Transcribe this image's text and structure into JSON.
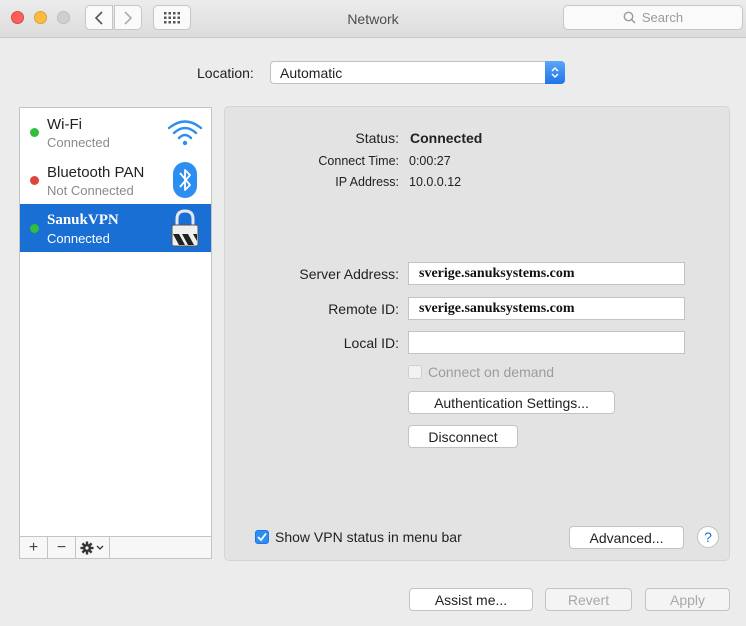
{
  "window": {
    "title": "Network",
    "search_placeholder": "Search"
  },
  "location": {
    "label": "Location:",
    "value": "Automatic"
  },
  "services": [
    {
      "name": "Wi-Fi",
      "status": "Connected",
      "status_color": "#2fbf3c",
      "icon": "wifi-icon",
      "selected": false
    },
    {
      "name": "Bluetooth PAN",
      "status": "Not Connected",
      "status_color": "#e0443e",
      "icon": "bluetooth-icon",
      "selected": false
    },
    {
      "name": "SanukVPN",
      "status": "Connected",
      "status_color": "#2fbf3c",
      "icon": "vpn-lock-icon",
      "selected": true
    }
  ],
  "sidebar_tools": {
    "add": "+",
    "remove": "−",
    "action": "gear-icon"
  },
  "detail": {
    "status_label": "Status:",
    "status_value": "Connected",
    "connect_time_label": "Connect Time:",
    "connect_time_value": "0:00:27",
    "ip_label": "IP Address:",
    "ip_value": "10.0.0.12",
    "server_label": "Server Address:",
    "server_value": "sverige.sanuksystems.com",
    "remote_label": "Remote ID:",
    "remote_value": "sverige.sanuksystems.com",
    "local_label": "Local ID:",
    "local_value": "",
    "connect_on_demand_label": "Connect on demand",
    "connect_on_demand_checked": false,
    "auth_button": "Authentication Settings...",
    "disconnect_button": "Disconnect",
    "show_status_label": "Show VPN status in menu bar",
    "show_status_checked": true,
    "advanced_button": "Advanced...",
    "help_label": "?"
  },
  "footer": {
    "assist_button": "Assist me...",
    "revert_button": "Revert",
    "apply_button": "Apply"
  },
  "colors": {
    "selection": "#1a6fd4",
    "accent": "#1f74e8"
  }
}
